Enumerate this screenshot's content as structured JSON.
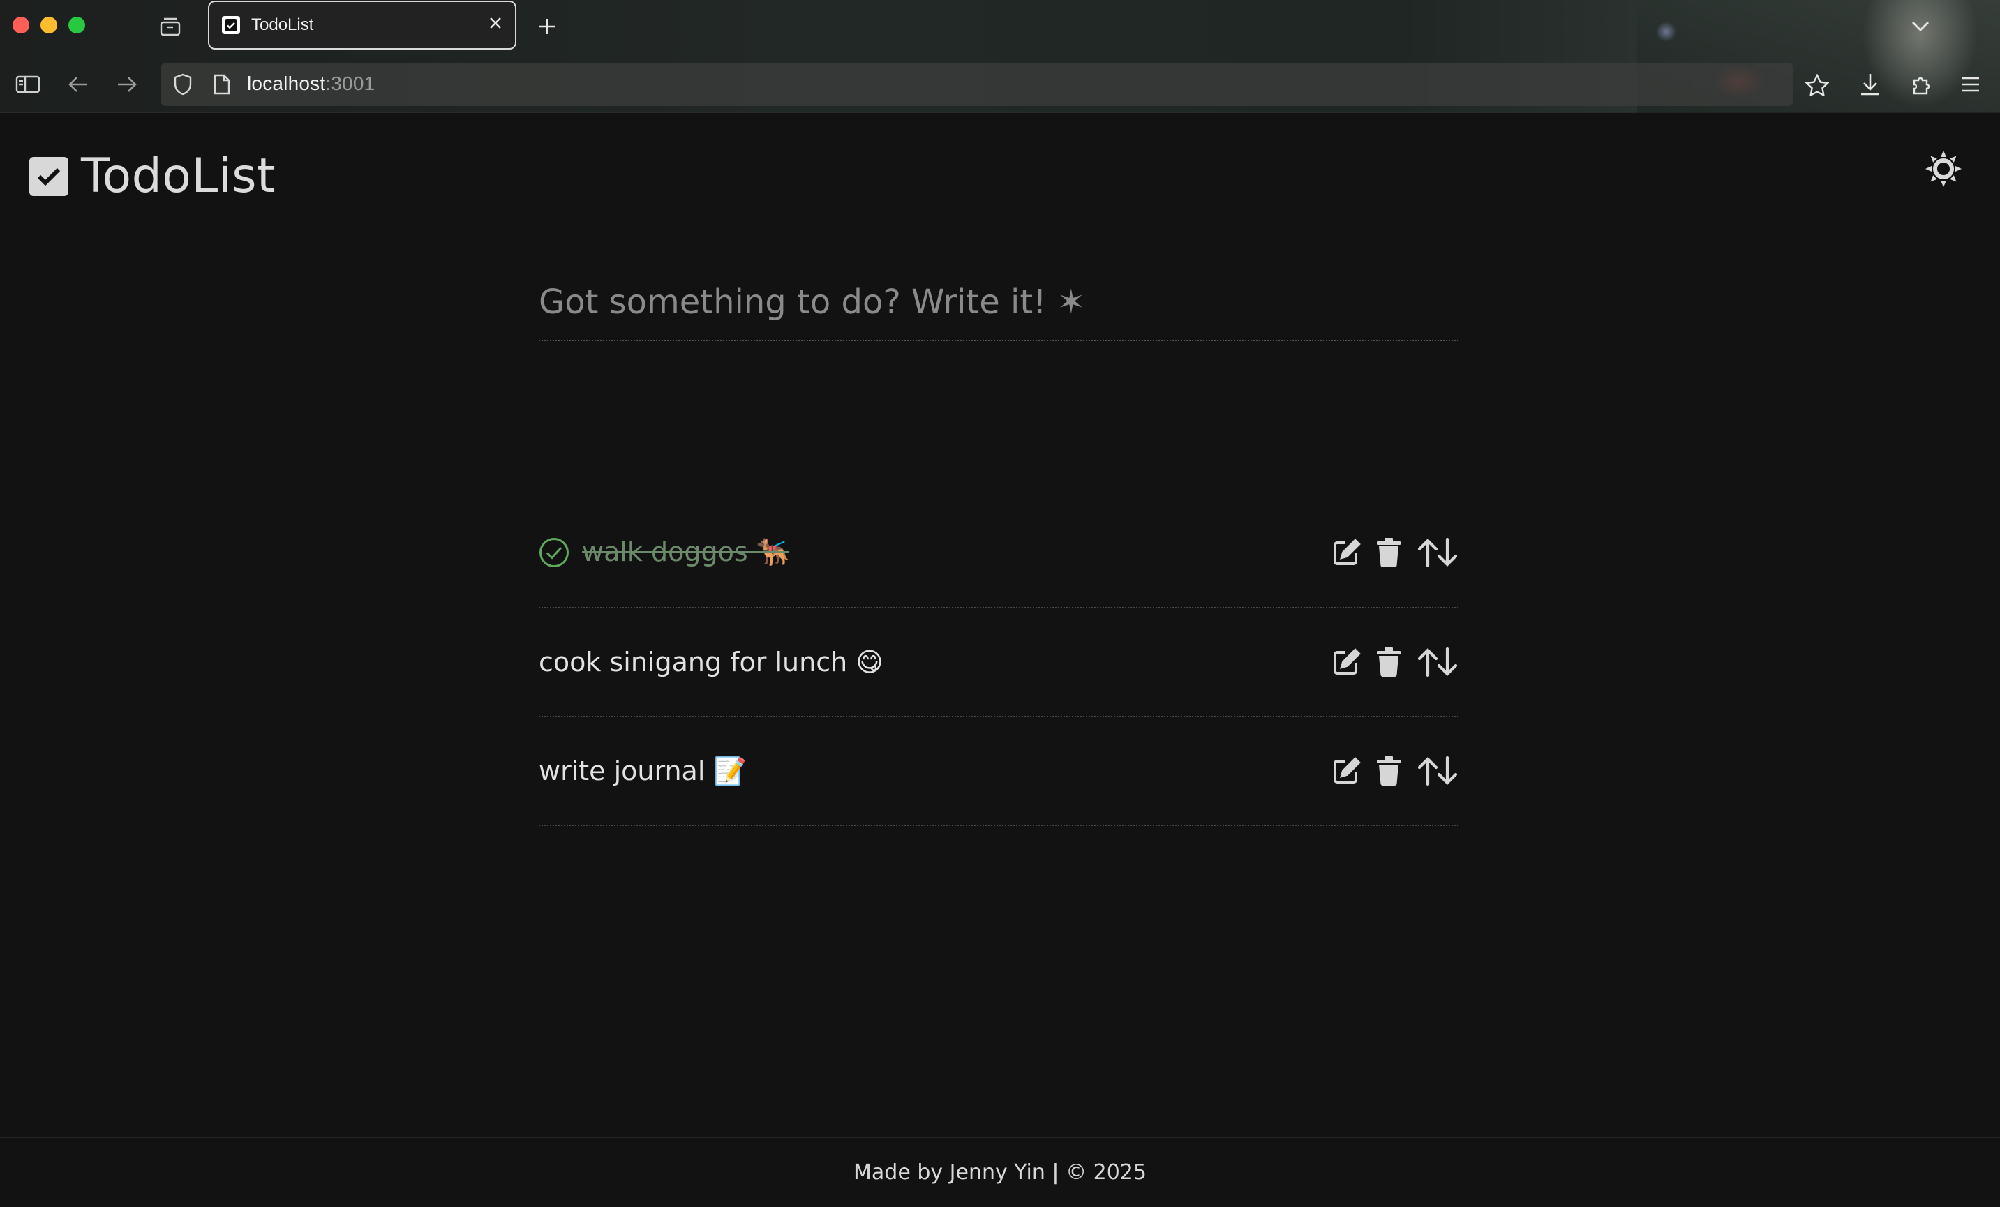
{
  "browser": {
    "tab_title": "TodoList",
    "url_host": "localhost",
    "url_port": ":3001"
  },
  "app": {
    "title": "TodoList",
    "theme_toggle_icon": "sun-icon"
  },
  "composer": {
    "placeholder": "Got something to do? Write it! ✶",
    "value": ""
  },
  "todos": [
    {
      "text": "walk doggos 🐕‍🦺",
      "completed": true
    },
    {
      "text": "cook sinigang for lunch 😋",
      "completed": false
    },
    {
      "text": "write journal 📝",
      "completed": false
    }
  ],
  "footer": {
    "text": "Made by Jenny Yin | © 2025"
  },
  "colors": {
    "background": "#121212",
    "completed_green": "#5fa85c",
    "completed_text": "#6a8a69",
    "text": "#e2e2e2",
    "placeholder": "#8a8a8a"
  }
}
